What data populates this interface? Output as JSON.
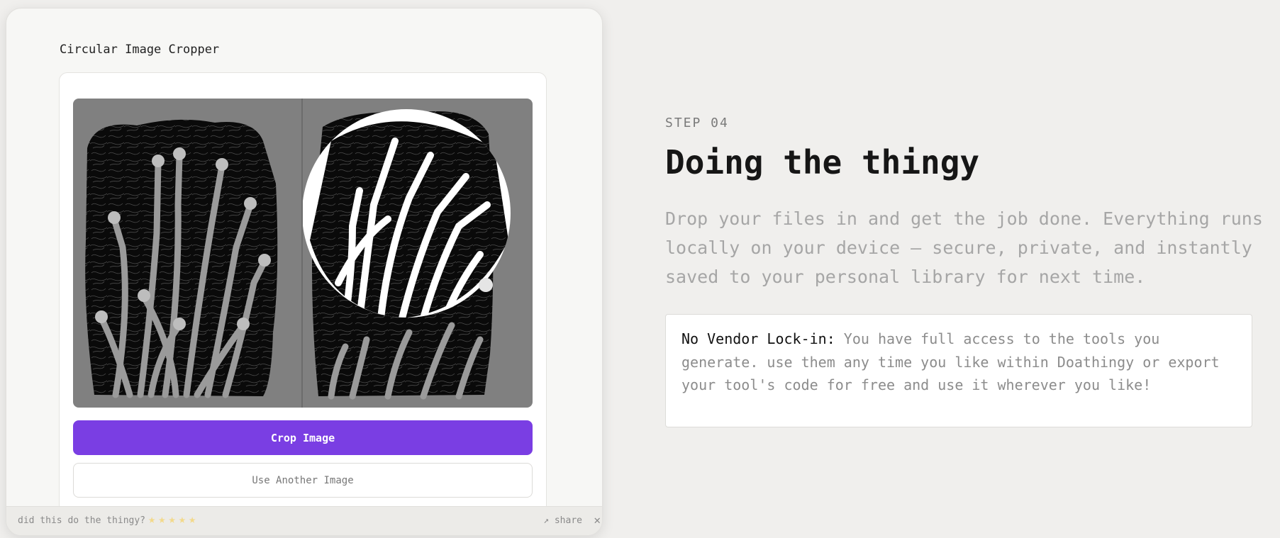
{
  "tool": {
    "title": "Circular Image Cropper",
    "crop_label": "Crop Image",
    "another_label": "Use Another Image"
  },
  "feedback": {
    "question": "did this do the thingy?",
    "rating_max": 5,
    "share_label": "↗ share",
    "close_label": "✕"
  },
  "info": {
    "step": "STEP 04",
    "heading": "Doing the thingy",
    "lead": "Drop your files in and get the job done. Everything runs locally on your device — secure, private, and instantly saved to your personal library for next time.",
    "note_label": "No Vendor Lock-in:",
    "note_text": " You have full access to the tools you generate. use them any time you like within Doathingy or export your tool's code for free and use it wherever you like!"
  },
  "colors": {
    "accent": "#7a3ee3",
    "star": "#f3d98a",
    "page_bg": "#f0efed"
  },
  "icons": [
    "star-icon",
    "share-icon",
    "close-icon",
    "crop-handle-icon"
  ]
}
